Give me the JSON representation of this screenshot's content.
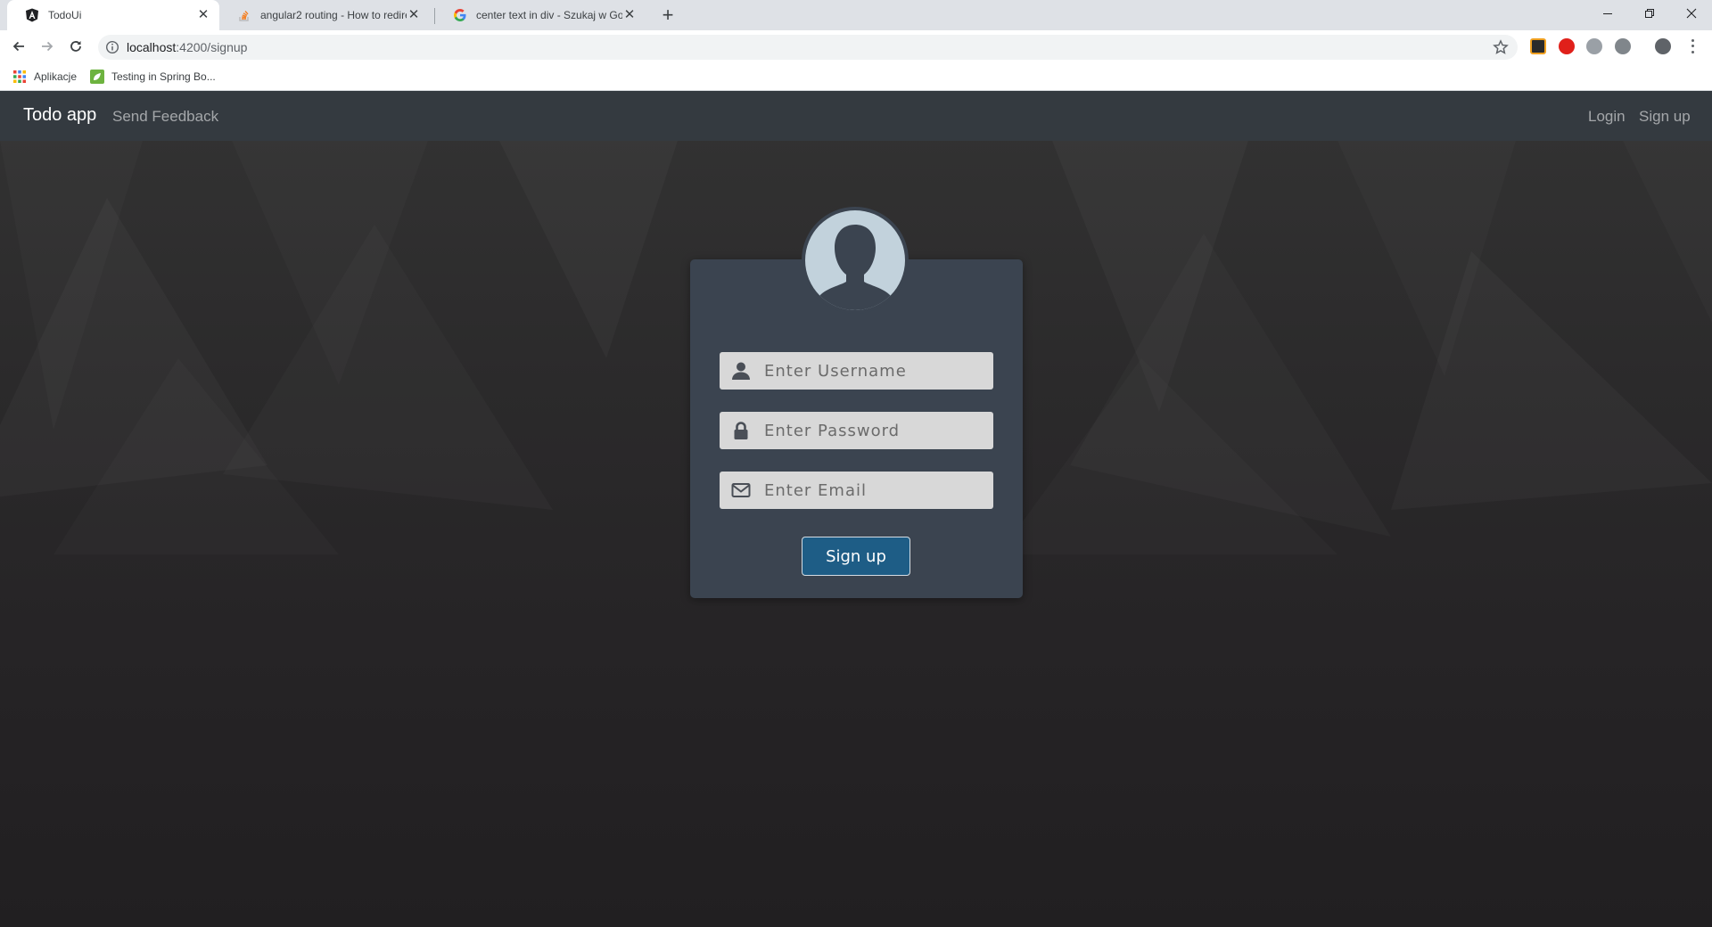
{
  "browser": {
    "tabs": [
      {
        "title": "TodoUi",
        "icon": "angular-icon",
        "active": true
      },
      {
        "title": "angular2 routing - How to redire",
        "icon": "stackoverflow-icon",
        "active": false
      },
      {
        "title": "center text in div - Szukaj w Goo",
        "icon": "google-icon",
        "active": false
      }
    ],
    "url_host": "localhost",
    "url_path": ":4200/signup",
    "bookmarks": [
      {
        "label": "Aplikacje",
        "icon": "apps-grid-icon"
      },
      {
        "label": "Testing in Spring Bo...",
        "icon": "spring-leaf-icon"
      }
    ]
  },
  "app": {
    "brand": "Todo app",
    "nav_left": [
      "Send Feedback"
    ],
    "nav_right": [
      "Login",
      "Sign up"
    ]
  },
  "form": {
    "username_placeholder": "Enter Username",
    "password_placeholder": "Enter Password",
    "email_placeholder": "Enter Email",
    "submit_label": "Sign up"
  },
  "colors": {
    "navbar": "#343a40",
    "card": "#3b4450",
    "button": "#1e5d86",
    "input": "#d8d8d8"
  }
}
